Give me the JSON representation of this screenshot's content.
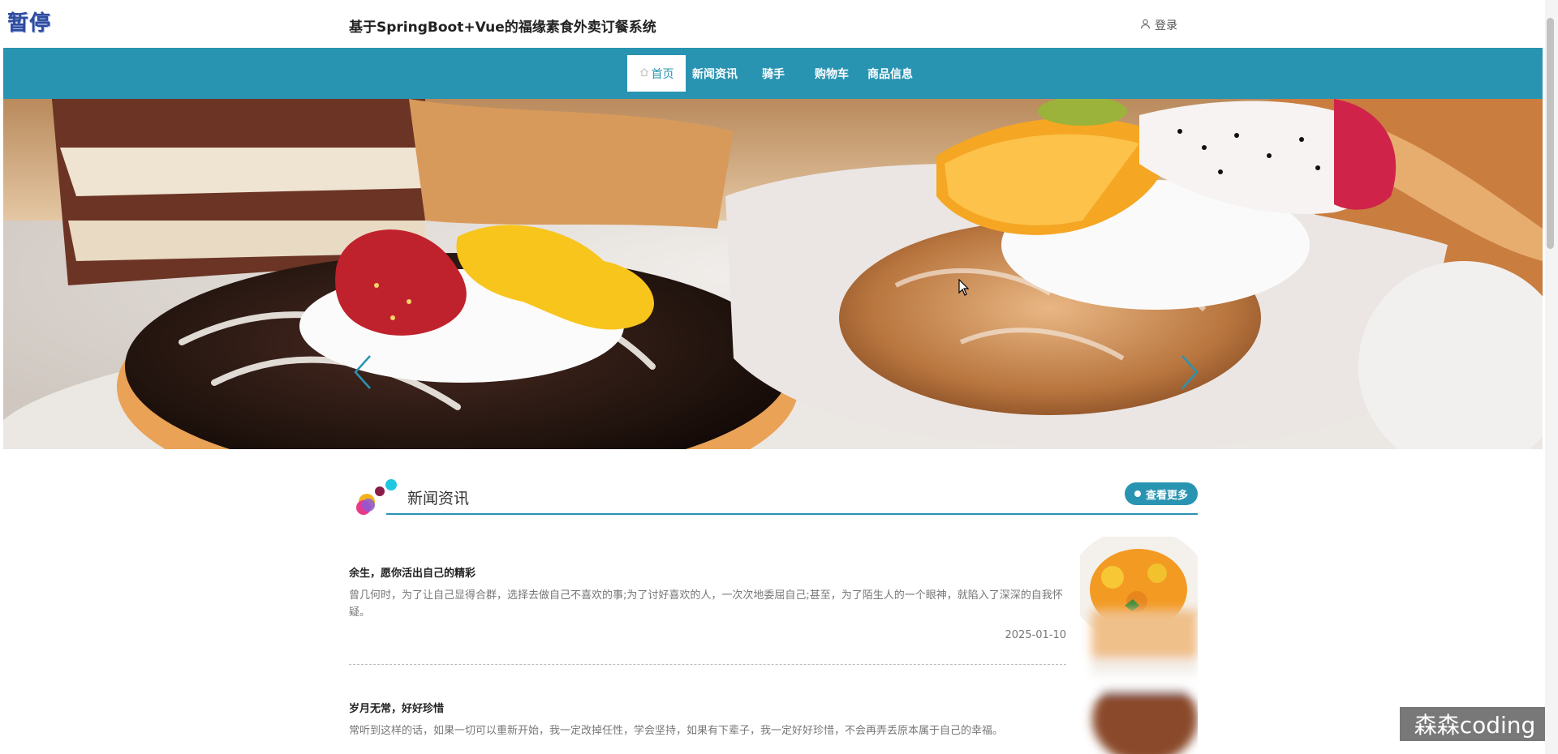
{
  "header": {
    "pause_badge": "暂停",
    "site_title": "基于SpringBoot+Vue的福缘素食外卖订餐系统",
    "login_label": "登录"
  },
  "nav": {
    "items": [
      {
        "label": "首页",
        "icon": "home-icon",
        "active": true
      },
      {
        "label": "新闻资讯",
        "active": false
      },
      {
        "label": "骑手",
        "active": false
      },
      {
        "label": "购物车",
        "active": false
      },
      {
        "label": "商品信息",
        "active": false
      }
    ]
  },
  "banner": {
    "prev_icon": "chevron-left-icon",
    "next_icon": "chevron-right-icon"
  },
  "news": {
    "section_title": "新闻资讯",
    "more_label": "查看更多",
    "items": [
      {
        "title": "余生，愿你活出自己的精彩",
        "desc": "曾几何时，为了让自己显得合群，选择去做自己不喜欢的事;为了讨好喜欢的人，一次次地委屈自己;甚至，为了陌生人的一个眼神，就陷入了深深的自我怀疑。",
        "date": "2025-01-10"
      },
      {
        "title": "岁月无常，好好珍惜",
        "desc": "常听到这样的话，如果一切可以重新开始，我一定改掉任性，学会坚持，如果有下辈子，我一定好好珍惜，不会再弄丢原本属于自己的幸福。"
      }
    ]
  },
  "watermark": "森森coding",
  "colors": {
    "primary": "#2994b2",
    "title_text": "#222222",
    "muted_text": "#777777"
  }
}
